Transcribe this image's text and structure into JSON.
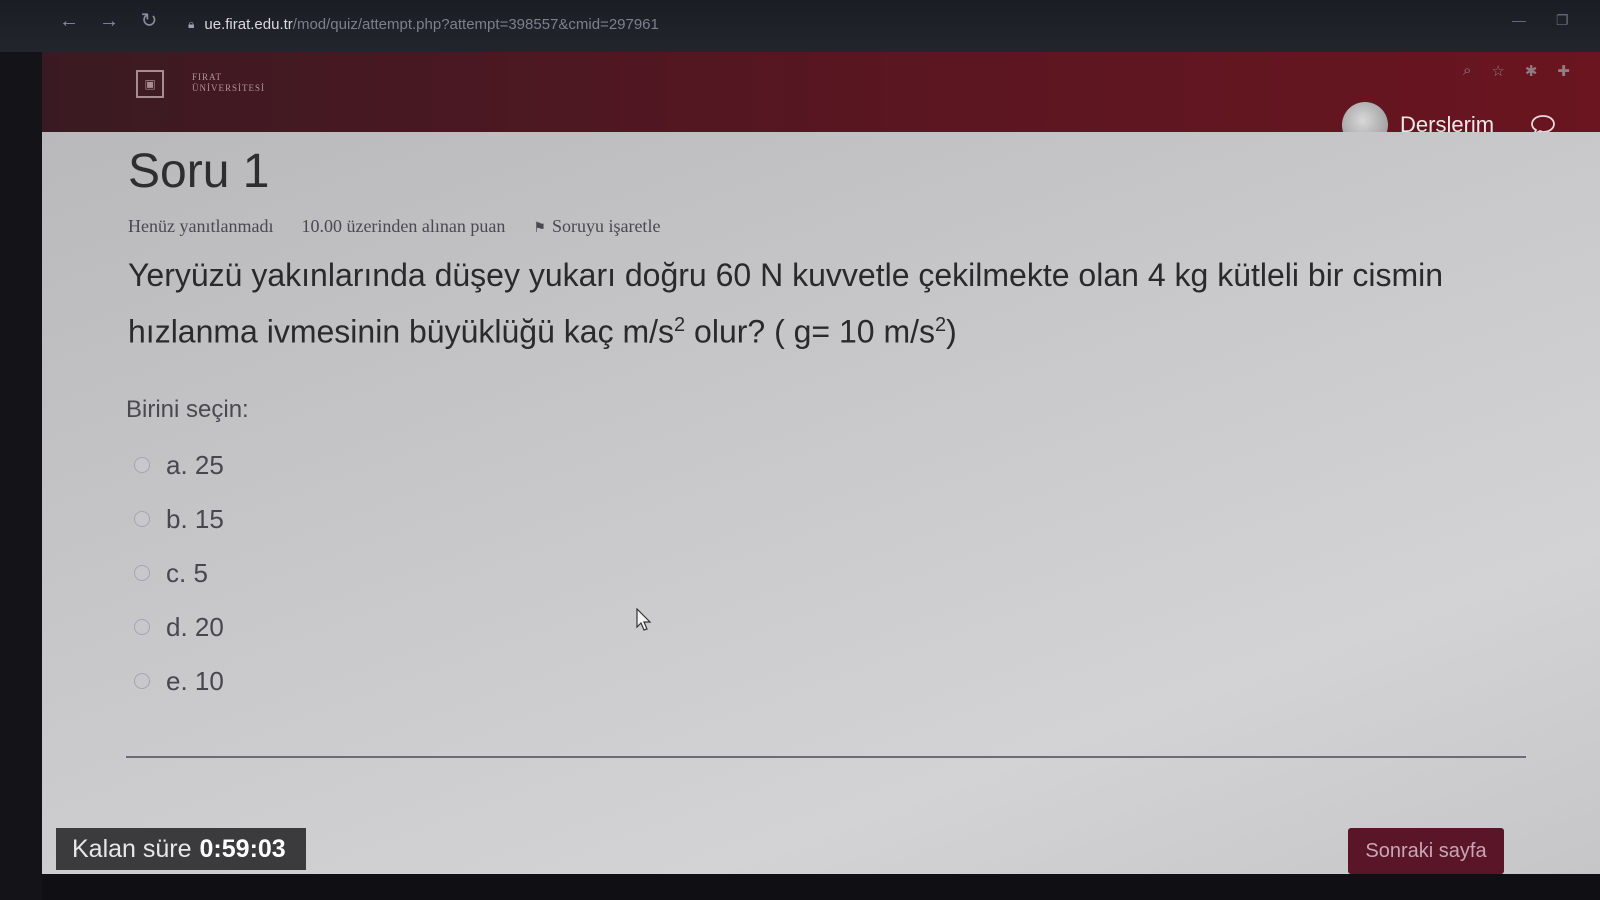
{
  "browser": {
    "url_host": "ue.firat.edu.tr",
    "url_path": "/mod/quiz/attempt.php?attempt=398557&cmid=297961"
  },
  "header": {
    "logo_text": "FIRAT\nÜNİVERSİTESİ",
    "my_courses": "Derslerim"
  },
  "question": {
    "title": "Soru 1",
    "status": "Henüz yanıtlanmadı",
    "points": "10.00 üzerinden alınan puan",
    "flag_label": "Soruyu işaretle",
    "text_part1": "Yeryüzü yakınlarında düşey yukarı doğru 60 N kuvvetle çekilmekte olan 4 kg kütleli bir cismin hızlanma ivmesinin büyüklüğü kaç m/s",
    "sup1": "2",
    "text_part2": " olur? ( g= 10 m/s",
    "sup2": "2",
    "text_part3": ")",
    "choose_label": "Birini seçin:",
    "answers": [
      "a. 25",
      "b. 15",
      "c. 5",
      "d. 20",
      "e. 10"
    ]
  },
  "footer": {
    "timer_label": "Kalan süre",
    "timer_value": "0:59:03",
    "next_button": "Sonraki sayfa"
  },
  "colors": {
    "header_bg": "#5a1621",
    "next_button_bg": "#5a1528",
    "timer_bg": "#3b3b3e"
  }
}
